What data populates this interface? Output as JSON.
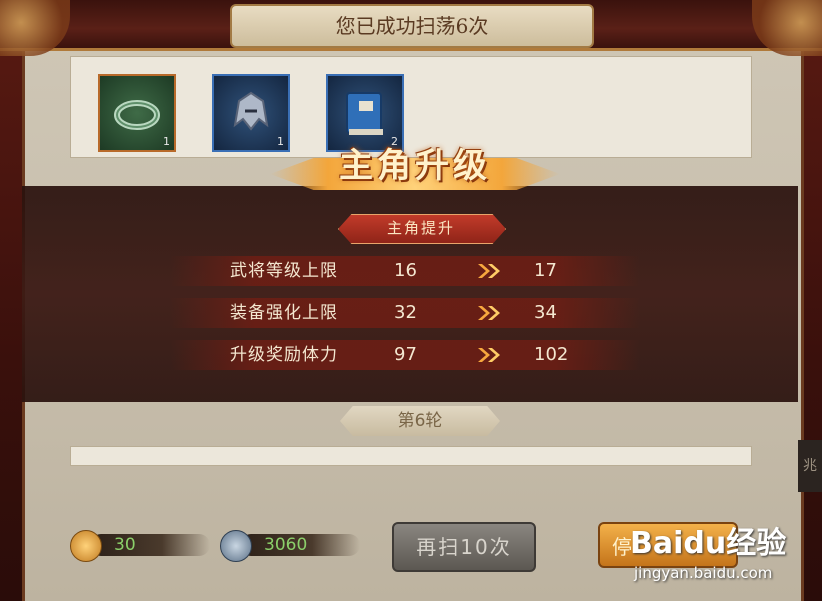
{
  "header": {
    "title": "您已成功扫荡6次"
  },
  "rewards": [
    {
      "icon": "bracelet-icon",
      "count": "1"
    },
    {
      "icon": "helmet-icon",
      "count": "1"
    },
    {
      "icon": "book-icon",
      "count": "2"
    }
  ],
  "popup": {
    "title": "主角升级",
    "subtitle": "主角提升",
    "rows": [
      {
        "label": "武将等级上限",
        "from": "16",
        "to": "17"
      },
      {
        "label": "装备强化上限",
        "from": "32",
        "to": "34"
      },
      {
        "label": "升级奖励体力",
        "from": "97",
        "to": "102"
      }
    ]
  },
  "round": {
    "label": "第6轮"
  },
  "resources": {
    "gold": "30",
    "silver": "3060"
  },
  "buttons": {
    "sweep": "再扫10次",
    "confirm": "停"
  },
  "side_tab": {
    "label": "兆"
  },
  "watermark": {
    "main": "Baidu经验",
    "sub": "jingyan.baidu.com"
  },
  "colors": {
    "accent": "#f3a63b",
    "value_green": "#8bd06a",
    "red_tag": "#c23b2a"
  }
}
